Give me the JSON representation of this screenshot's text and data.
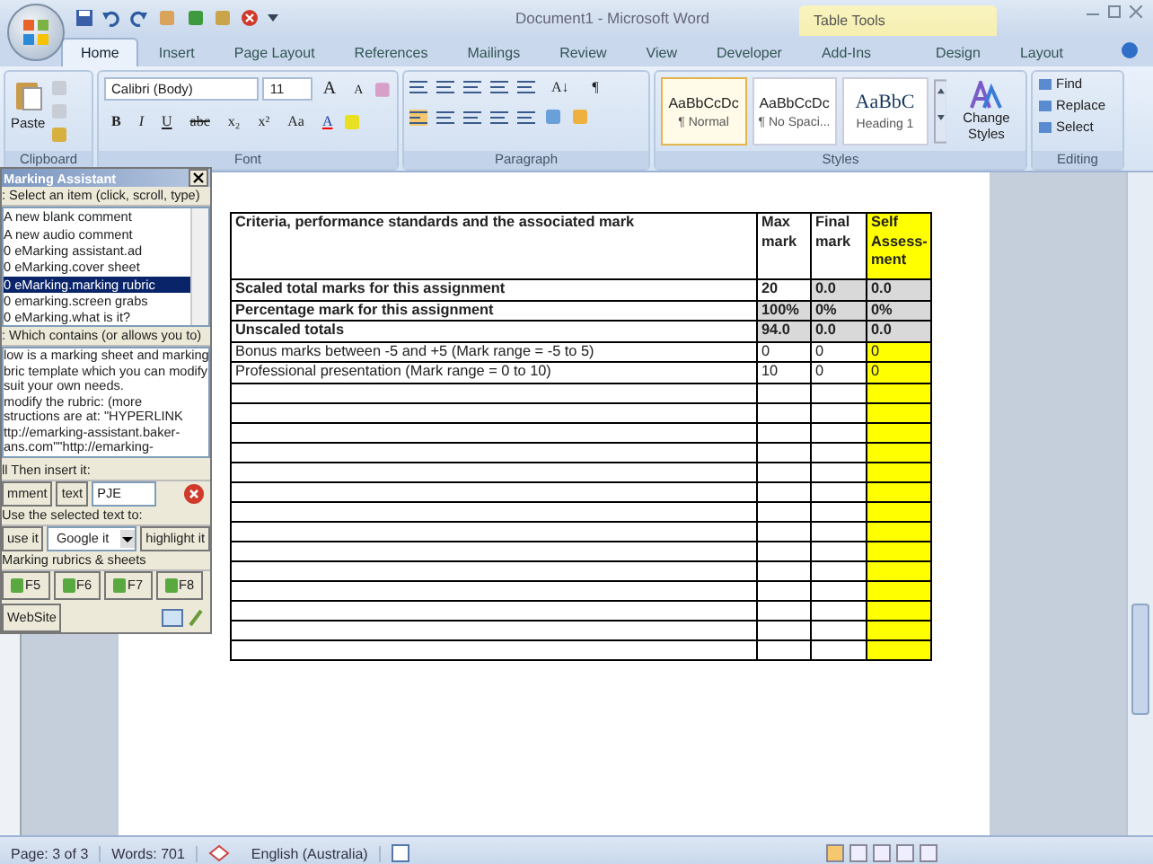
{
  "window": {
    "title": "Document1 - Microsoft Word",
    "contextual_tab": "Table Tools"
  },
  "tabs": [
    {
      "label": "Home",
      "selected": true
    },
    {
      "label": "Insert",
      "selected": false
    },
    {
      "label": "Page Layout",
      "selected": false
    },
    {
      "label": "References",
      "selected": false
    },
    {
      "label": "Mailings",
      "selected": false
    },
    {
      "label": "Review",
      "selected": false
    },
    {
      "label": "View",
      "selected": false
    },
    {
      "label": "Developer",
      "selected": false
    },
    {
      "label": "Add-Ins",
      "selected": false
    },
    {
      "label": "Design",
      "selected": false
    },
    {
      "label": "Layout",
      "selected": false
    }
  ],
  "ribbon": {
    "clipboard": {
      "paste": "Paste",
      "label": "Clipboard"
    },
    "font": {
      "face": "Calibri (Body)",
      "size": "11",
      "grow": "A",
      "shrink": "A",
      "buttons": [
        "B",
        "I",
        "U",
        "abc",
        "x₂",
        "x²",
        "Aa",
        "A"
      ],
      "label": "Font"
    },
    "paragraph": {
      "sort": "A↓",
      "pilcrow": "¶",
      "label": "Paragraph"
    },
    "styles": {
      "gallery": [
        {
          "sample": "AaBbCcDc",
          "name": "¶ Normal",
          "selected": true
        },
        {
          "sample": "AaBbCcDc",
          "name": "¶ No Spaci...",
          "selected": false
        },
        {
          "sample": "AaBbC",
          "name": "Heading 1",
          "selected": false
        }
      ],
      "change_styles": "Change Styles",
      "label": "Styles"
    },
    "editing": {
      "items": [
        "Find",
        "Replace",
        "Select"
      ],
      "label": "Editing"
    }
  },
  "assistant": {
    "title": "Marking Assistant",
    "section1": ": Select an item (click, scroll, type)",
    "items": [
      {
        "label": "A new blank comment",
        "selected": false
      },
      {
        "label": "A new audio comment",
        "selected": false
      },
      {
        "label": "0 eMarking assistant.ad",
        "selected": false
      },
      {
        "label": "0 eMarking.cover sheet",
        "selected": false
      },
      {
        "label": "0 eMarking.marking rubric",
        "selected": true
      },
      {
        "label": "0 emarking.screen grabs",
        "selected": false
      },
      {
        "label": "0 eMarking.what is it?",
        "selected": false
      }
    ],
    "section2": ": Which contains (or allows you to)",
    "description": [
      "low is a marking sheet and marking",
      "bric template which you can modify",
      "suit your own needs.",
      "modify the rubric: (more",
      "structions are at: \"HYPERLINK",
      "ttp://emarking-assistant.baker-",
      "ans.com\"\"http://emarking-"
    ],
    "section3": "ll Then insert it:",
    "insert_buttons": [
      "mment",
      "text"
    ],
    "insert_value": "PJE",
    "section4": "Use the selected text to:",
    "use_button": "use it",
    "search_choice": "Google it",
    "highlight_button": "highlight it",
    "section5": "Marking rubrics & sheets",
    "key_buttons": [
      "F5",
      "F6",
      "F7",
      "F8"
    ],
    "website": "WebSite"
  },
  "table": {
    "columns": [
      "Criteria, performance standards and the associated mark",
      "Max mark",
      "Final mark",
      "Self Assess-ment"
    ],
    "rows": [
      {
        "bold": true,
        "cells": [
          {
            "text": "Scaled total marks for this assignment"
          },
          {
            "text": "20"
          },
          {
            "text": "0.0",
            "color": "#d9d9d9"
          },
          {
            "text": "0.0",
            "color": "#d9d9d9"
          }
        ]
      },
      {
        "bold": true,
        "cells": [
          {
            "text": "Percentage mark for this assignment"
          },
          {
            "text": "100%",
            "color": "#d9d9d9"
          },
          {
            "text": "0%",
            "color": "#d9d9d9"
          },
          {
            "text": "0%",
            "color": "#d9d9d9"
          }
        ]
      },
      {
        "bold": true,
        "cells": [
          {
            "text": "Unscaled totals"
          },
          {
            "text": "94.0",
            "color": "#d9d9d9"
          },
          {
            "text": "0.0",
            "color": "#d9d9d9"
          },
          {
            "text": "0.0",
            "color": "#d9d9d9"
          }
        ]
      },
      {
        "bold": false,
        "cells": [
          {
            "text": "Bonus marks between -5 and +5 (Mark range = -5 to 5)"
          },
          {
            "text": "0"
          },
          {
            "text": "0"
          },
          {
            "text": "0",
            "color": "#ffff00"
          }
        ]
      },
      {
        "bold": false,
        "cells": [
          {
            "text": "Professional presentation (Mark range = 0 to 10)"
          },
          {
            "text": "10"
          },
          {
            "text": "0"
          },
          {
            "text": "0",
            "color": "#ffff00"
          }
        ]
      }
    ]
  },
  "status_bar": {
    "page": "Page: 3 of 3",
    "words": "Words: 701",
    "language": "English (Australia)"
  }
}
